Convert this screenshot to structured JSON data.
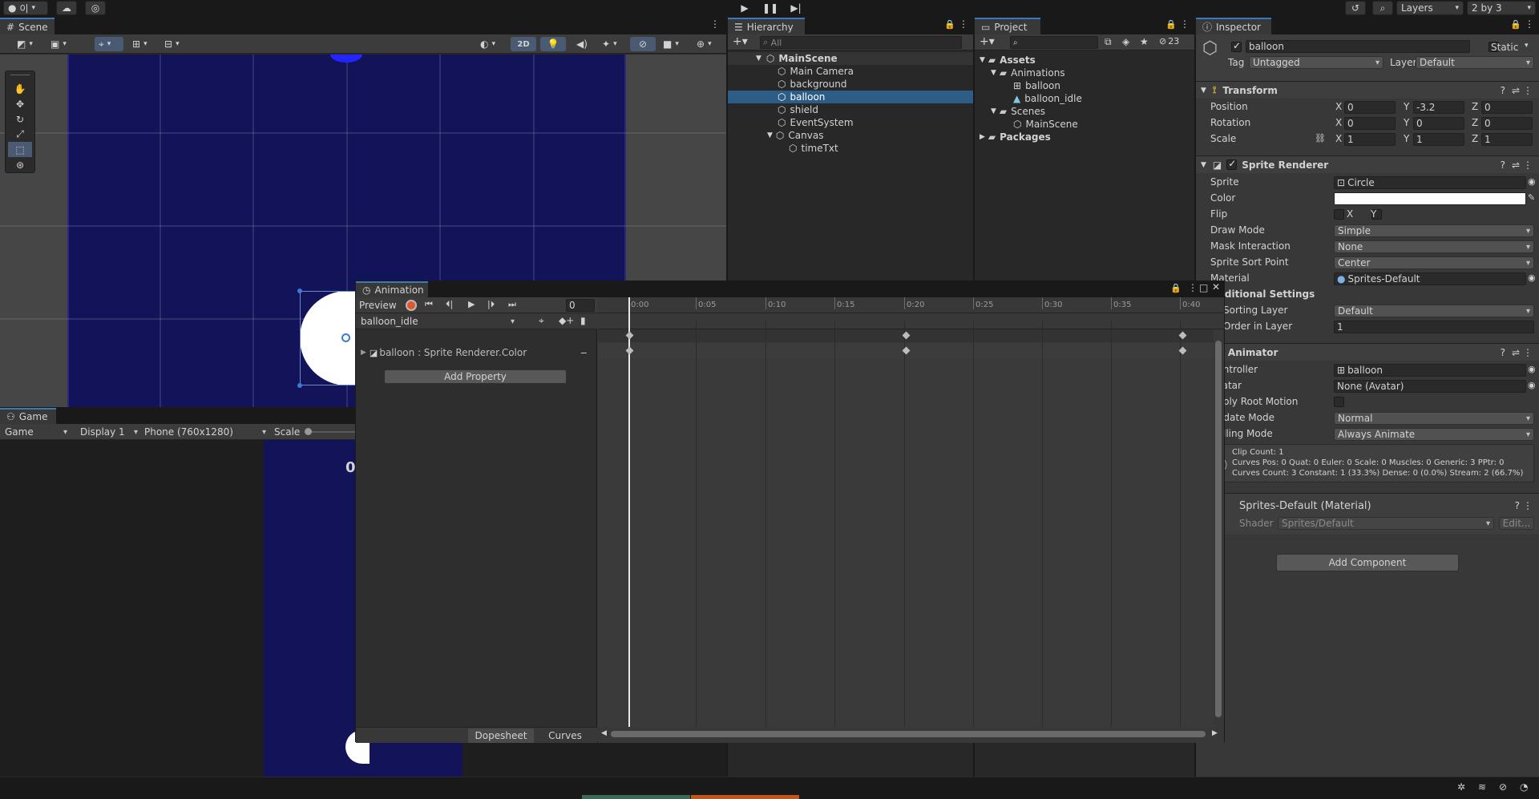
{
  "topbar": {
    "account_label": "이",
    "layers_label": "Layers",
    "layout_label": "2 by 3"
  },
  "scene": {
    "tab": "Scene",
    "mode_2d": "2D"
  },
  "game": {
    "tab": "Game",
    "view": "Game",
    "display": "Display 1",
    "resolution": "Phone (760x1280)",
    "scale_label": "Scale",
    "timer_text": "0"
  },
  "hierarchy": {
    "tab": "Hierarchy",
    "search_placeholder": "All",
    "root": "MainScene",
    "items": [
      "Main Camera",
      "background",
      "balloon",
      "shield",
      "EventSystem",
      "Canvas",
      "timeTxt"
    ]
  },
  "project": {
    "tab": "Project",
    "hidden_count": "23",
    "assets": "Assets",
    "animations": "Animations",
    "anim_items": [
      "balloon",
      "balloon_idle"
    ],
    "scenes": "Scenes",
    "scene_items": [
      "MainScene"
    ],
    "packages": "Packages"
  },
  "inspector": {
    "tab": "Inspector",
    "object_name": "balloon",
    "static_label": "Static",
    "tag_label": "Tag",
    "tag_value": "Untagged",
    "layer_label": "Layer",
    "layer_value": "Default",
    "transform": {
      "title": "Transform",
      "position_label": "Position",
      "rotation_label": "Rotation",
      "scale_label": "Scale",
      "position": [
        "0",
        "-3.2",
        "0"
      ],
      "rotation": [
        "0",
        "0",
        "0"
      ],
      "scale": [
        "1",
        "1",
        "1"
      ],
      "axes": [
        "X",
        "Y",
        "Z"
      ]
    },
    "sprite_renderer": {
      "title": "Sprite Renderer",
      "sprite_label": "Sprite",
      "sprite_value": "Circle",
      "color_label": "Color",
      "flip_label": "Flip",
      "flip_x": "X",
      "flip_y": "Y",
      "draw_mode_label": "Draw Mode",
      "draw_mode": "Simple",
      "mask_label": "Mask Interaction",
      "mask": "None",
      "sort_point_label": "Sprite Sort Point",
      "sort_point": "Center",
      "material_label": "Material",
      "material": "Sprites-Default",
      "additional_label": "Additional Settings",
      "sorting_layer_label": "Sorting Layer",
      "sorting_layer": "Default",
      "order_label": "Order in Layer",
      "order": "1"
    },
    "animator": {
      "title": "Animator",
      "controller_label": "Controller",
      "controller": "balloon",
      "avatar_label": "Avatar",
      "avatar": "None (Avatar)",
      "root_motion_label": "Apply Root Motion",
      "update_label": "Update Mode",
      "update": "Normal",
      "culling_label": "Culling Mode",
      "culling": "Always Animate",
      "info": [
        "Clip Count: 1",
        "Curves Pos: 0 Quat: 0 Euler: 0 Scale: 0 Muscles: 0 Generic: 3 PPtr: 0",
        "Curves Count: 3 Constant: 1 (33.3%) Dense: 0 (0.0%) Stream: 2 (66.7%)"
      ]
    },
    "material": {
      "title": "Sprites-Default (Material)",
      "shader_label": "Shader",
      "shader": "Sprites/Default",
      "edit_label": "Edit..."
    },
    "add_component": "Add Component"
  },
  "animation": {
    "tab": "Animation",
    "preview": "Preview",
    "frame": "0",
    "clip": "balloon_idle",
    "property": "balloon : Sprite Renderer.Color",
    "add_property": "Add Property",
    "dopesheet": "Dopesheet",
    "curves": "Curves",
    "ticks": [
      "0:00",
      "0:05",
      "0:10",
      "0:15",
      "0:20",
      "0:25",
      "0:30",
      "0:35",
      "0:40"
    ]
  },
  "colors": {
    "accent": "#3a79bb",
    "scene_bg": "#13135a",
    "selection": "#2c5d87",
    "record": "#e0562d",
    "timer_red": "#e01010"
  }
}
